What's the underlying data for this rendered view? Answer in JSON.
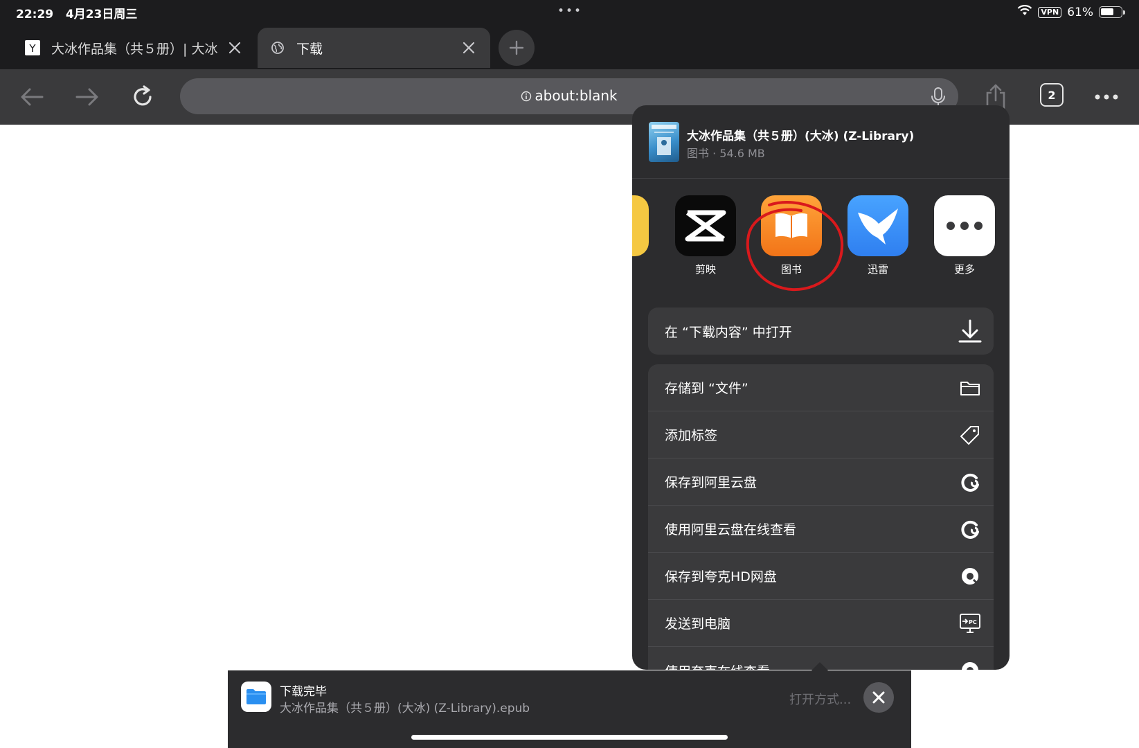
{
  "status_bar": {
    "time": "22:29",
    "date": "4月23日周三",
    "center_dots": "•••",
    "vpn": "VPN",
    "battery": "61%"
  },
  "tabs": [
    {
      "title": "大冰作品集（共５册）| 大冰",
      "favicon": "yandex-logo-icon",
      "active": false
    },
    {
      "title": "下载",
      "favicon": "globe-icon",
      "active": true
    }
  ],
  "toolbar": {
    "address": "about:blank",
    "tab_count": "2"
  },
  "share_sheet": {
    "file_title": "大冰作品集（共５册）(大冰) (Z-Library)",
    "file_subtitle": "图书 · 54.6 MB",
    "apps": [
      {
        "label": "剪映",
        "icon": "capcut-icon"
      },
      {
        "label": "图书",
        "icon": "books-icon"
      },
      {
        "label": "迅雷",
        "icon": "xunlei-icon"
      },
      {
        "label": "更多",
        "icon": "more-icon"
      }
    ],
    "primary_action": {
      "label": "在 “下载内容” 中打开",
      "icon": "download-icon"
    },
    "actions": [
      {
        "label": "存储到 “文件”",
        "icon": "folder-icon"
      },
      {
        "label": "添加标签",
        "icon": "tag-icon"
      },
      {
        "label": "保存到阿里云盘",
        "icon": "aliyun-drive-icon"
      },
      {
        "label": "使用阿里云盘在线查看",
        "icon": "aliyun-drive-icon"
      },
      {
        "label": "保存到夸克HD网盘",
        "icon": "quark-icon"
      },
      {
        "label": "发送到电脑",
        "icon": "send-to-pc-icon"
      },
      {
        "label": "使用夸克在线查看",
        "icon": "quark-icon"
      }
    ]
  },
  "download_bar": {
    "status": "下载完毕",
    "filename": "大冰作品集（共５册）(大冰) (Z-Library).epub",
    "open_with": "打开方式...",
    "file_icon": "files-app-icon"
  },
  "colors": {
    "chrome_dark": "#1c1c1e",
    "toolbar": "#3a3a3c",
    "sheet": "#2c2c2e",
    "annotation_red": "#d9191c",
    "books_orange": "#f68a1e",
    "xunlei_blue": "#2f8ff5"
  }
}
